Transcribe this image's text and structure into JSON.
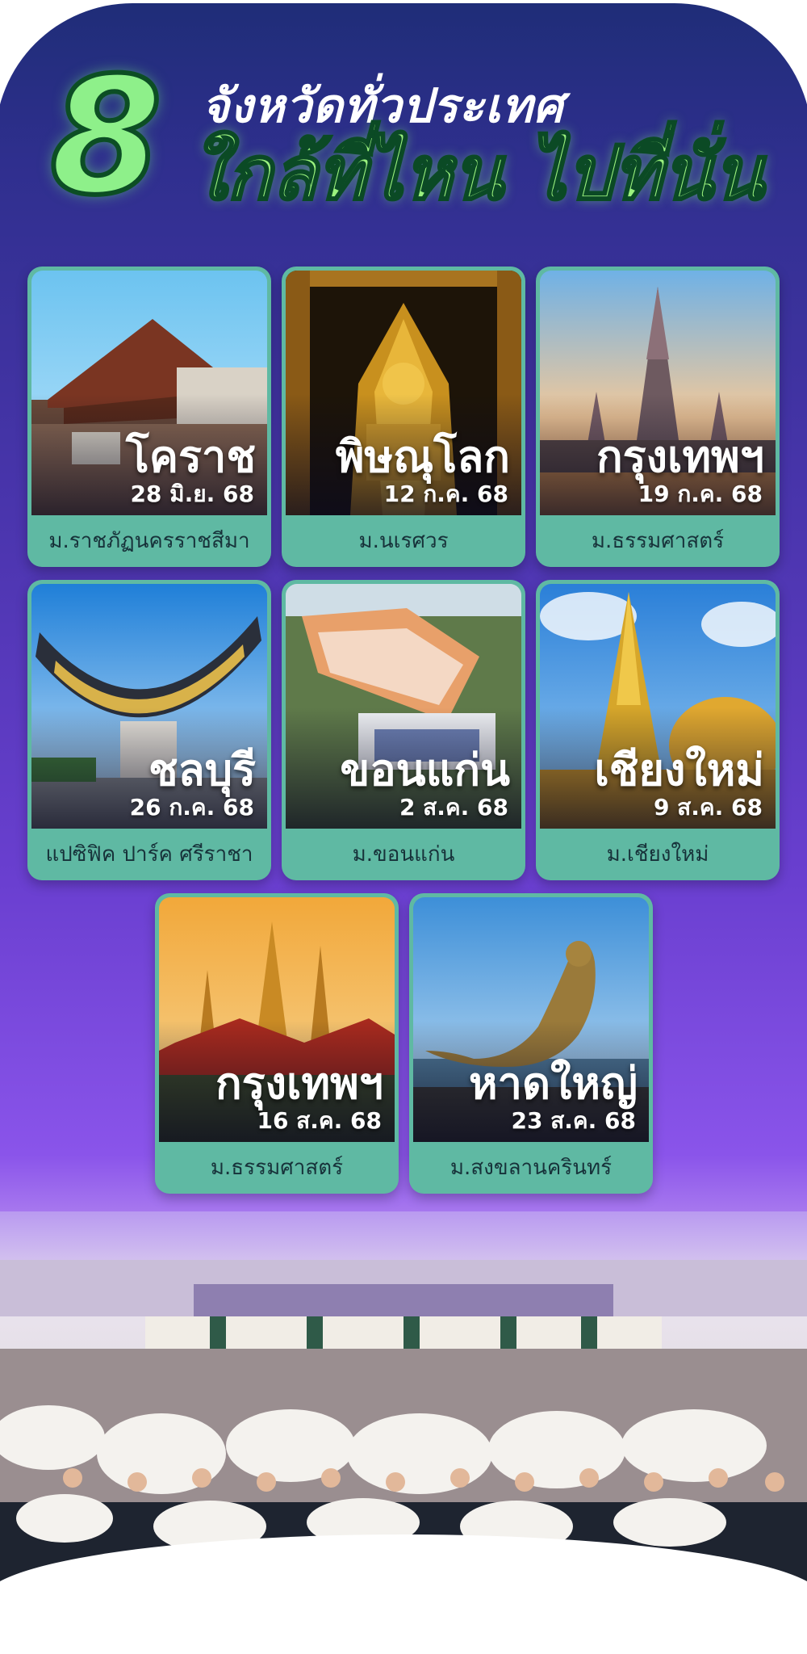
{
  "header": {
    "number": "8",
    "line1": "จังหวัดทั่วประเทศ",
    "line2": "ใกล้ที่ไหน ไปที่นั่น"
  },
  "cards": [
    {
      "city": "โคราช",
      "date": "28 มิ.ย. 68",
      "venue": "ม.ราชภัฏนครราชสีมา",
      "photo": "temple-gate-photo"
    },
    {
      "city": "พิษณุโลก",
      "date": "12 ก.ค. 68",
      "venue": "ม.นเรศวร",
      "photo": "golden-buddha-photo"
    },
    {
      "city": "กรุงเทพฯ",
      "date": "19 ก.ค. 68",
      "venue": "ม.ธรรมศาสตร์",
      "photo": "wat-arun-photo"
    },
    {
      "city": "ชลบุรี",
      "date": "26 ก.ค. 68",
      "venue": "แปซิฟิค ปาร์ค ศรีราชา",
      "photo": "bangsaen-sign-photo"
    },
    {
      "city": "ขอนแก่น",
      "date": "2 ส.ค. 68",
      "venue": "ม.ขอนแก่น",
      "photo": "auditorium-aerial-photo"
    },
    {
      "city": "เชียงใหม่",
      "date": "9 ส.ค. 68",
      "venue": "ม.เชียงใหม่",
      "photo": "golden-chedi-photo"
    },
    {
      "city": "กรุงเทพฯ",
      "date": "16 ส.ค. 68",
      "venue": "ม.ธรรมศาสตร์",
      "photo": "grand-palace-photo"
    },
    {
      "city": "หาดใหญ่",
      "date": "23 ส.ค. 68",
      "venue": "ม.สงขลานครินทร์",
      "photo": "mermaid-statue-photo"
    }
  ],
  "footer_photo": "students-group-photo",
  "colors": {
    "card_bg": "#5fb9a3",
    "headline_green": "#9bf27e",
    "panel_top": "#1f2d78",
    "panel_bottom": "#8a54ea"
  }
}
